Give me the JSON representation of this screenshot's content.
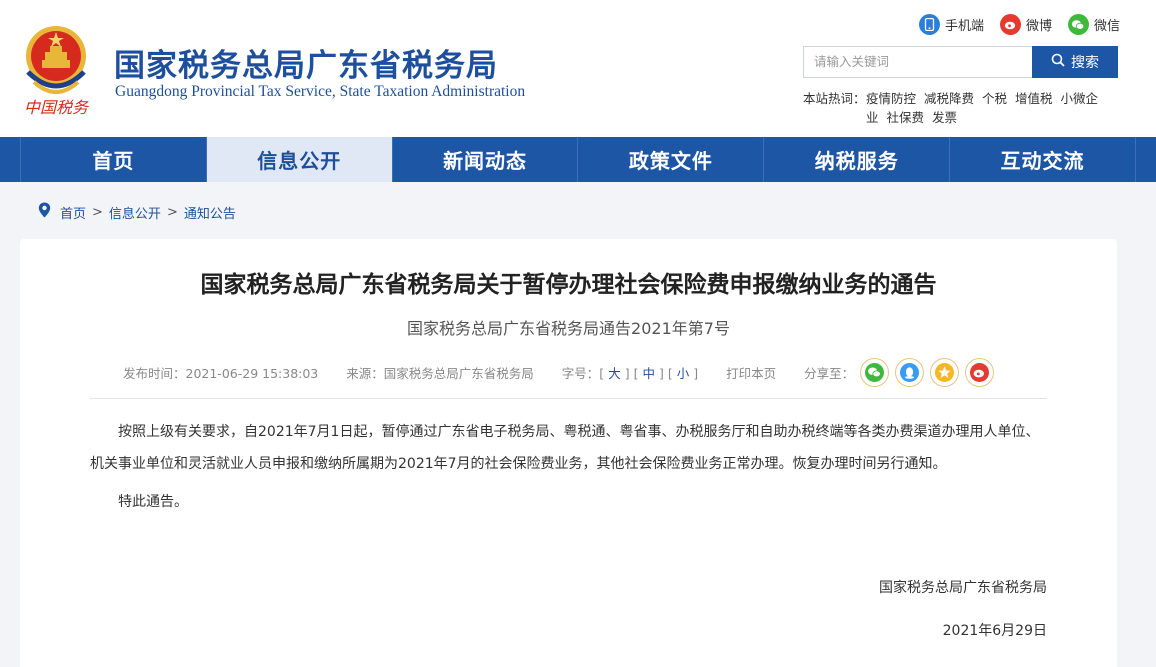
{
  "header": {
    "title_cn": "国家税务总局广东省税务局",
    "title_en": "Guangdong Provincial Tax Service, State Taxation Administration",
    "emblem_caption": "中国税务",
    "top_links": [
      {
        "label": "手机端",
        "icon": "phone-icon",
        "color": "#2b7fd8"
      },
      {
        "label": "微博",
        "icon": "weibo-icon",
        "color": "#e53a2f"
      },
      {
        "label": "微信",
        "icon": "wechat-icon",
        "color": "#3fb83c"
      }
    ],
    "search": {
      "placeholder": "请输入关键词",
      "button_label": "搜索"
    },
    "hot_words": {
      "label": "本站热词：",
      "items": [
        "疫情防控",
        "减税降费",
        "个税",
        "增值税",
        "小微企业",
        "社保费",
        "发票"
      ]
    }
  },
  "nav": {
    "items": [
      "首页",
      "信息公开",
      "新闻动态",
      "政策文件",
      "纳税服务",
      "互动交流"
    ],
    "active": "信息公开"
  },
  "breadcrumb": {
    "items": [
      "首页",
      "信息公开",
      "通知公告"
    ],
    "separator": ">"
  },
  "article": {
    "title": "国家税务总局广东省税务局关于暂停办理社会保险费申报缴纳业务的通告",
    "doc_number": "国家税务总局广东省税务局通告2021年第7号",
    "meta": {
      "publish_time": "发布时间：2021-06-29 15:38:03",
      "source": "来源：国家税务总局广东省税务局",
      "font_size_label": "字号：",
      "font_sizes": [
        "大",
        "中",
        "小"
      ],
      "print_label": "打印本页",
      "share_label": "分享至："
    },
    "share_icons": [
      "wechat-share-icon",
      "qq-share-icon",
      "qzone-share-icon",
      "weibo-share-icon"
    ],
    "paragraphs": [
      "按照上级有关要求，自2021年7月1日起，暂停通过广东省电子税务局、粤税通、粤省事、办税服务厅和自助办税终端等各类办费渠道办理用人单位、机关事业单位和灵活就业人员申报和缴纳所属期为2021年7月的社会保险费业务，其他社会保险费业务正常办理。恢复办理时间另行通知。",
      "特此通告。"
    ],
    "signature_org": "国家税务总局广东省税务局",
    "signature_date": "2021年6月29日"
  },
  "colors": {
    "brand_blue": "#1e56a6",
    "title_blue": "#1e4f9c",
    "nav_active_bg": "#dfe8f4",
    "page_bg": "#f2f4f7"
  }
}
